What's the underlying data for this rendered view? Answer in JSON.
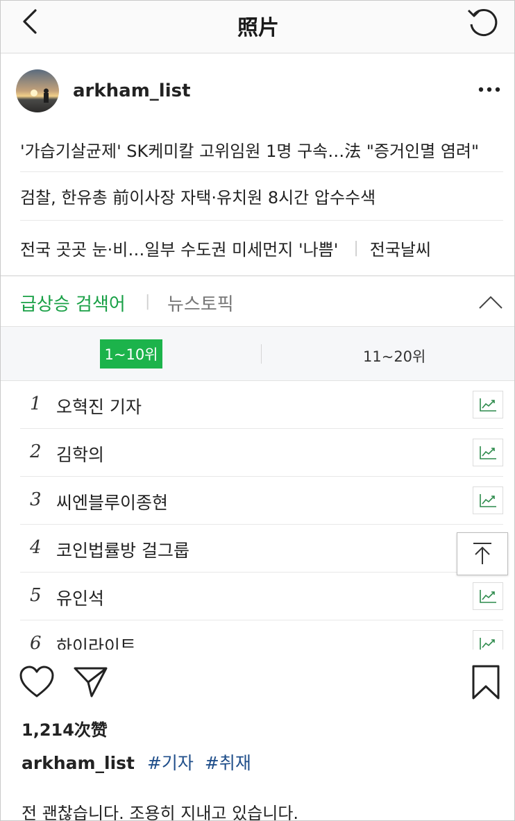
{
  "header": {
    "title": "照片"
  },
  "post": {
    "username": "arkham_list"
  },
  "news": [
    {
      "text": "'가습기살균제' SK케미칼 고위임원 1명 구속…法 \"증거인멸 염려\""
    },
    {
      "text": "검찰, 한유총 前이사장 자택·유치원 8시간 압수수색"
    },
    {
      "text": "전국 곳곳 눈·비…일부 수도권 미세먼지 '나쁨'",
      "tail": "전국날씨",
      "separator": "|"
    }
  ],
  "tabs": {
    "main": "급상승 검색어",
    "separator": "|",
    "sub": "뉴스토픽"
  },
  "ranges": {
    "active": "1~10위",
    "other": "11~20위"
  },
  "ranks": [
    {
      "num": "1",
      "keyword": "오혁진 기자"
    },
    {
      "num": "2",
      "keyword": "김학의"
    },
    {
      "num": "3",
      "keyword": "씨엔블루이종현"
    },
    {
      "num": "4",
      "keyword": "코인법률방 걸그룹"
    },
    {
      "num": "5",
      "keyword": "유인석"
    },
    {
      "num": "6",
      "keyword": "하이라이트"
    }
  ],
  "icons": {
    "back": "chevron-left-icon",
    "refresh": "refresh-icon",
    "more": "more-horizontal-icon",
    "collapse": "chevron-up-icon",
    "trend": "trend-chart-icon",
    "scroll_top": "arrow-up-icon",
    "like": "heart-icon",
    "share": "send-icon",
    "save": "bookmark-icon"
  },
  "colors": {
    "accent_green": "#19a046",
    "active_range_bg": "#1cb34b",
    "hashtag": "#1f4e8a"
  },
  "engagement": {
    "likes": "1,214次赞"
  },
  "caption": {
    "username": "arkham_list",
    "tags": [
      "#기자",
      "#취재"
    ]
  },
  "comment": {
    "text": "전 괜찮습니다. 조용히 지내고 있습니다."
  }
}
